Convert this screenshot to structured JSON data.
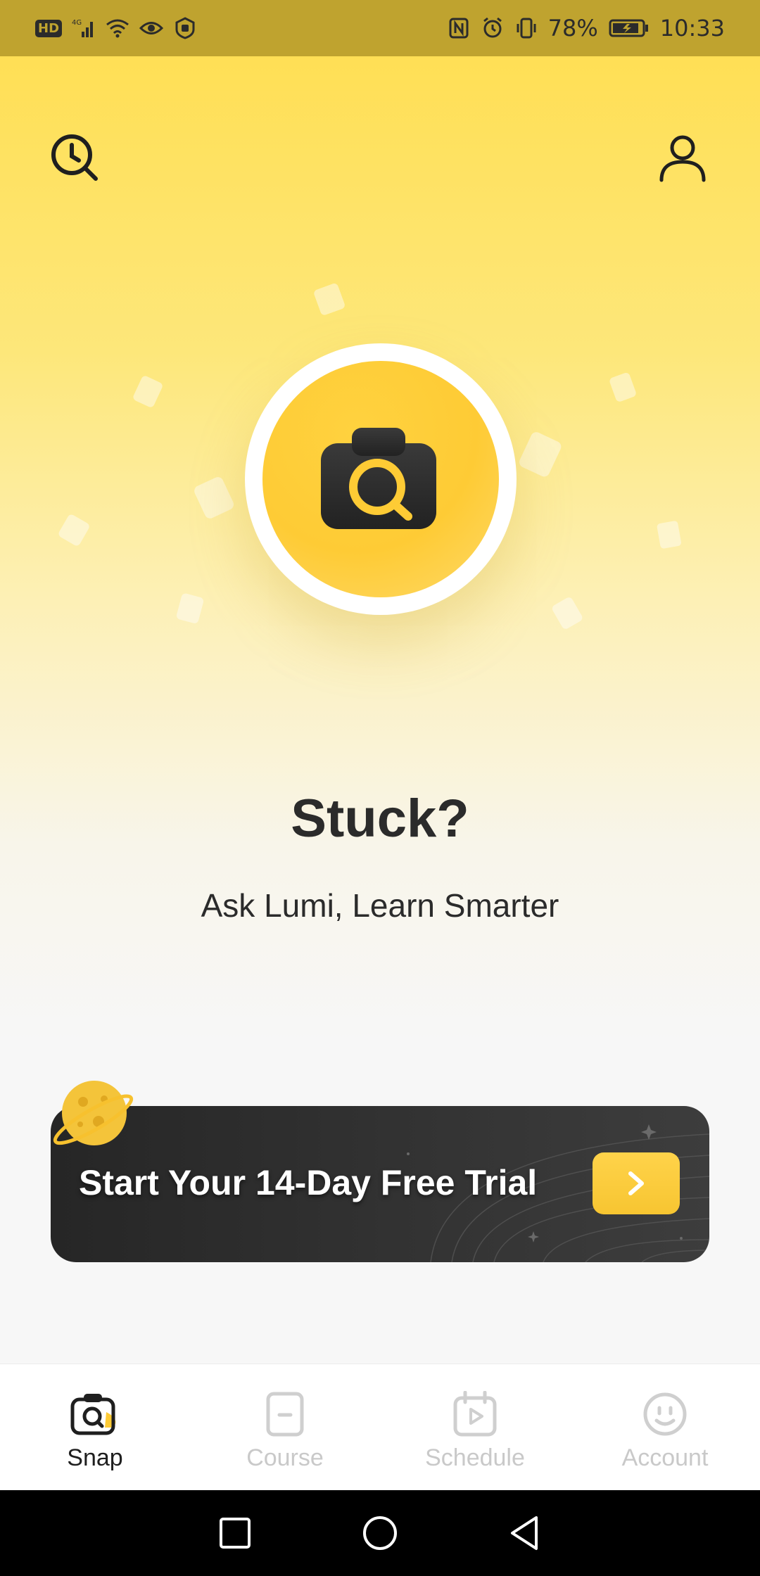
{
  "status_bar": {
    "left_badge": "HD",
    "battery_percent": "78%",
    "time": "10:33",
    "icons_left": [
      "hd-icon",
      "signal-4g-icon",
      "wifi-icon",
      "eye-icon",
      "hand-shield-icon"
    ],
    "icons_right": [
      "nfc-icon",
      "alarm-icon",
      "vibrate-icon",
      "battery-charging-icon"
    ]
  },
  "header": {
    "left_icon": "history-icon",
    "right_icon": "profile-icon"
  },
  "hero": {
    "title": "Stuck?",
    "subtitle": "Ask Lumi, Learn Smarter",
    "camera_icon": "camera-search-icon"
  },
  "promo": {
    "text": "Start Your 14-Day Free Trial",
    "action_icon": "chevron-right-icon",
    "decoration_icon": "planet-icon"
  },
  "bottom_nav": {
    "items": [
      {
        "label": "Snap",
        "icon": "camera-search-icon",
        "active": true
      },
      {
        "label": "Course",
        "icon": "course-icon",
        "active": false
      },
      {
        "label": "Schedule",
        "icon": "calendar-play-icon",
        "active": false
      },
      {
        "label": "Account",
        "icon": "smiley-icon",
        "active": false
      }
    ]
  },
  "colors": {
    "accent": "#fecb35",
    "status_bar_bg": "#bfa32f",
    "banner_bg": "#2e2e2e",
    "text_dark": "#2b2b2b",
    "inactive_nav": "#c9c9c9"
  }
}
